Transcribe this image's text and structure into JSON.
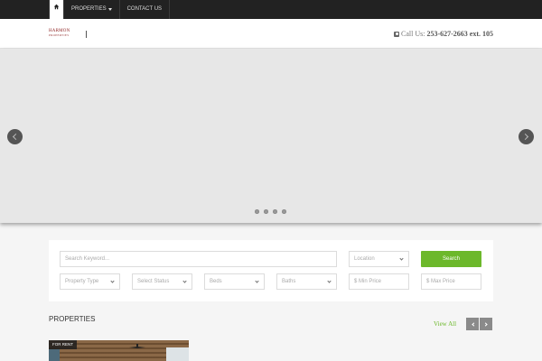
{
  "nav": {
    "items": [
      {
        "label": "PROPERTIES",
        "dropdown": true
      },
      {
        "label": "CONTACT US",
        "dropdown": false
      }
    ]
  },
  "header": {
    "logo_line1": "HARMON",
    "logo_line2": "PROPERTIES",
    "phone_label": "Call Us:",
    "phone_number": "253-627-2663 ext. 105"
  },
  "slider": {
    "dot_count": 4
  },
  "search": {
    "keyword_placeholder": "Search Keyword...",
    "location_placeholder": "Location",
    "button_label": "Search",
    "property_type": "Property Type",
    "status": "Select Status",
    "beds": "Beds",
    "baths": "Baths",
    "min_price": "$ Min Price",
    "max_price": "$ Max Price"
  },
  "properties": {
    "title": "PROPERTIES",
    "view_all": "View All",
    "first_card_badge": "FOR RENT"
  },
  "colors": {
    "accent_green": "#6cb82b",
    "topbar": "#222222",
    "logo_red": "#8b1e1e"
  }
}
